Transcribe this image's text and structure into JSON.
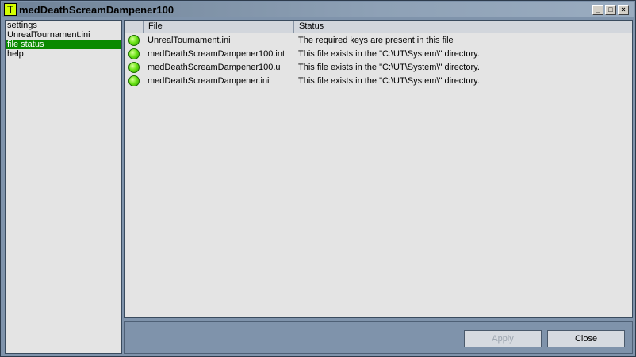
{
  "window": {
    "title": "medDeathScreamDampener100",
    "icon_letter": "T",
    "controls": {
      "minimize": "_",
      "maximize": "□",
      "close": "×"
    }
  },
  "sidebar": {
    "items": [
      {
        "label": "settings",
        "selected": false
      },
      {
        "label": "UnrealTournament.ini",
        "selected": false
      },
      {
        "label": "file status",
        "selected": true
      },
      {
        "label": "help",
        "selected": false
      }
    ]
  },
  "table": {
    "columns": {
      "icon": "",
      "file": "File",
      "status": "Status"
    },
    "rows": [
      {
        "status_icon": "green-status-icon",
        "file": "UnrealTournament.ini",
        "status": "The required keys are present in this file"
      },
      {
        "status_icon": "green-status-icon",
        "file": "medDeathScreamDampener100.int",
        "status": "This file exists in the \"C:\\UT\\System\\\" directory."
      },
      {
        "status_icon": "green-status-icon",
        "file": "medDeathScreamDampener100.u",
        "status": "This file exists in the \"C:\\UT\\System\\\" directory."
      },
      {
        "status_icon": "green-status-icon",
        "file": "medDeathScreamDampener.ini",
        "status": "This file exists in the \"C:\\UT\\System\\\" directory."
      }
    ]
  },
  "footer": {
    "apply_label": "Apply",
    "apply_enabled": false,
    "close_label": "Close"
  },
  "colors": {
    "window_bg": "#7f93ab",
    "selection": "#0a8a00",
    "status_ok": "#4fd500"
  }
}
